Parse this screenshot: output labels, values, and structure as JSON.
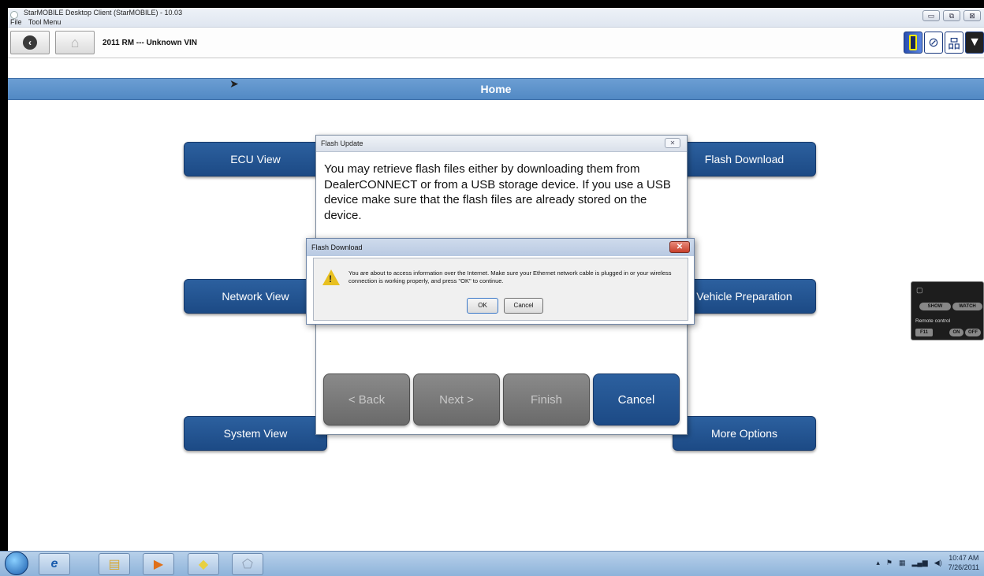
{
  "window": {
    "title": "StarMOBILE Desktop Client (StarMOBILE) - 10.03",
    "menu": [
      "File",
      "Tool Menu"
    ],
    "controls": [
      "▭",
      "⧉",
      "⊠"
    ]
  },
  "toolbar": {
    "vehicle": "2011  RM  ---  Unknown VIN"
  },
  "page": {
    "title": "Home"
  },
  "tiles": {
    "ecu_view": "ECU View",
    "network_view": "Network View",
    "system_view": "System View",
    "flash_download": "Flash Download",
    "vehicle_preparation": "Vehicle Preparation",
    "more_options": "More Options"
  },
  "flash_update": {
    "title": "Flash Update",
    "message": "You may retrieve flash files either by downloading them from DealerCONNECT or from a USB storage device.  If you use a USB device make sure that the flash files are already stored on the device.",
    "buttons": {
      "back": "< Back",
      "next": "Next >",
      "finish": "Finish",
      "cancel": "Cancel"
    }
  },
  "flash_download": {
    "title": "Flash Download",
    "close": "✕",
    "message": "You are about to access information over the Internet.  Make sure your Ethernet network cable is plugged in or your wireless connection is working properly, and press \"OK\" to continue.",
    "ok": "OK",
    "cancel": "Cancel"
  },
  "remote_widget": {
    "show": "SHOW",
    "watch": "WATCH",
    "label": "Remote control",
    "key": "F11",
    "on": "ON",
    "off": "OFF"
  },
  "taskbar": {
    "time": "10:47 AM",
    "date": "7/26/2011"
  },
  "colors": {
    "accent": "#1f4f8c",
    "header": "#5e94cc",
    "disabled_button": "#787878"
  }
}
